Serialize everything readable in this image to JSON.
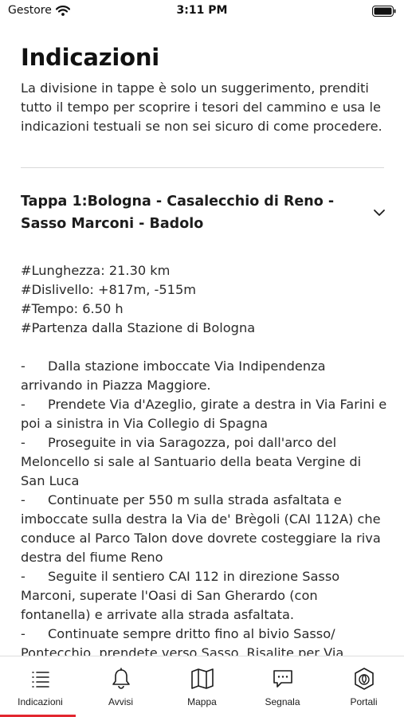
{
  "status_bar": {
    "carrier": "Gestore",
    "time": "3:11 PM"
  },
  "page": {
    "title": "Indicazioni",
    "intro": "La divisione in tappe è solo un suggerimento, prenditi tutto il tempo per scoprire i tesori del cammino e usa le indicazioni testuali se non sei sicuro di come procedere."
  },
  "stage": {
    "title": "Tappa 1:Bologna - Casalecchio di Reno - Sasso Marconi - Badolo",
    "expanded": true,
    "stats": [
      "#Lunghezza: 21.30 km",
      "#Dislivello: +817m, -515m",
      "#Tempo: 6.50 h",
      "#Partenza dalla Stazione di Bologna"
    ],
    "bullet": "-",
    "directions": [
      "Dalla stazione imboccate Via Indipendenza arrivando in Piazza Maggiore.",
      "Prendete Via d'Azeglio, girate a destra in Via Farini e poi a sinistra in Via Collegio di Spagna",
      "Proseguite in via Saragozza, poi dall'arco del Meloncello si sale al Santuario della beata Vergine di San Luca",
      "Continuate per 550 m sulla strada asfaltata e imboccate sulla destra la Via de' Brègoli (CAI 112A) che conduce al Parco Talon dove dovrete costeggiare la riva destra del fiume Reno",
      "Seguite il sentiero CAI 112 in direzione Sasso Marconi, superate l'Oasi di San Gherardo (con fontanella) e arrivate alla strada asfaltata.",
      "Continuate sempre dritto fino al bivio Sasso/ Pontecchio, prendete verso Sasso. Risalite per Via"
    ]
  },
  "tabbar": {
    "active_color": "#e3262f",
    "tabs": [
      {
        "label": "Indicazioni",
        "icon": "list-icon",
        "active": true
      },
      {
        "label": "Avvisi",
        "icon": "bell-icon",
        "active": false
      },
      {
        "label": "Mappa",
        "icon": "map-icon",
        "active": false
      },
      {
        "label": "Segnala",
        "icon": "chat-icon",
        "active": false
      },
      {
        "label": "Portali",
        "icon": "portal-icon",
        "active": false
      }
    ]
  }
}
